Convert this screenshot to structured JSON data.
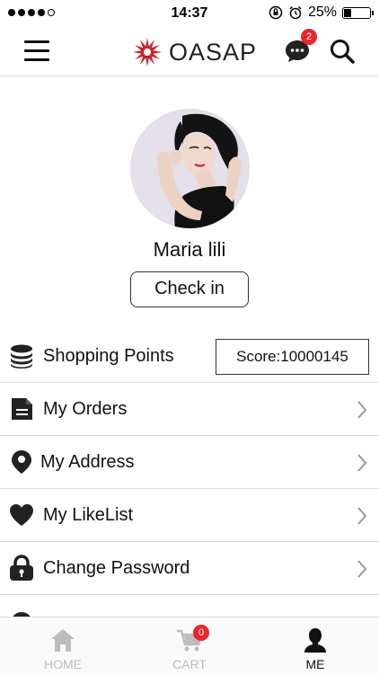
{
  "status_bar": {
    "time": "14:37",
    "battery": "25%",
    "battery_level": 0.25
  },
  "header": {
    "brand": "OASAP",
    "chat_badge": "2"
  },
  "profile": {
    "username": "Maria lili",
    "checkin_label": "Check in"
  },
  "menu": {
    "points": {
      "label": "Shopping Points",
      "score": "Score:10000145"
    },
    "items": [
      {
        "label": "My Orders",
        "icon": "document-icon"
      },
      {
        "label": "My Address",
        "icon": "location-pin-icon"
      },
      {
        "label": "My LikeList",
        "icon": "heart-icon"
      },
      {
        "label": "Change Password",
        "icon": "lock-icon"
      }
    ]
  },
  "tabs": [
    {
      "label": "HOME",
      "icon": "home-icon",
      "active": false
    },
    {
      "label": "CART",
      "icon": "cart-icon",
      "active": false,
      "badge": "0"
    },
    {
      "label": "ME",
      "icon": "person-icon",
      "active": true
    }
  ],
  "colors": {
    "accent": "#e8282a",
    "brand": "#c8202a",
    "inactive_tab": "#bdbdbd",
    "text": "#111111"
  }
}
